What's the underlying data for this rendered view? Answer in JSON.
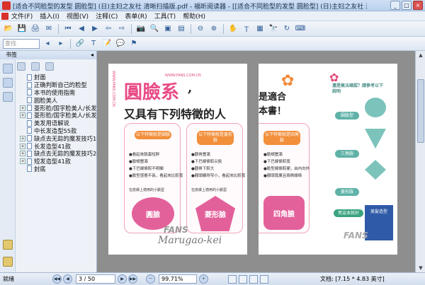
{
  "window": {
    "title": "[适合不同脸型的发型 圆脸型] (日)主妇之友社 清晰扫描版.pdf - 福昕阅读器 - [[适合不同脸型的发型 圆脸型] (日)主妇之友社 清晰扫描版.pdf]",
    "buttons": {
      "minimize": "_",
      "maximize": "□",
      "close": "×"
    }
  },
  "menu": {
    "items": [
      "文件(F)",
      "插入(I)",
      "视图(V)",
      "注释(C)",
      "表单(R)",
      "工具(T)",
      "帮助(H)"
    ]
  },
  "toolbar": {
    "search_placeholder": "查找",
    "zoom_out": "⊖",
    "zoom_in": "⊕",
    "prev": "◀",
    "next": "▶"
  },
  "bookmarks": {
    "header": "书签",
    "collapse": "◂",
    "items": [
      {
        "label": "封面",
        "toggle": ""
      },
      {
        "label": "正确判断自己的脸型",
        "toggle": ""
      },
      {
        "label": "本书的使用指南",
        "toggle": ""
      },
      {
        "label": "圆脸美人",
        "toggle": ""
      },
      {
        "label": "菱形脸/国字脸美人/长发",
        "toggle": "+"
      },
      {
        "label": "菱形脸/国字脸美人/长发",
        "toggle": "+"
      },
      {
        "label": "美发用语解说",
        "toggle": ""
      },
      {
        "label": "中长发造型55款",
        "toggle": ""
      },
      {
        "label": "缺点去无踪的魔发技巧1",
        "toggle": "+"
      },
      {
        "label": "长发造型41款",
        "toggle": "+"
      },
      {
        "label": "缺点去无踪的魔发技巧2",
        "toggle": "+"
      },
      {
        "label": "短发造型41款",
        "toggle": "+"
      },
      {
        "label": "封底",
        "toggle": ""
      }
    ]
  },
  "document": {
    "left_page": {
      "url": "WWW.FANS.COM.CN",
      "title": "圓臉系",
      "comma": ",",
      "subtitle": "又具有下列特徵的人",
      "cards": [
        {
          "tag": "以下特徵就是圓臉",
          "bullets": [
            "●看起來臉蛋短胖",
            "●臉頰豐滿",
            "●下巴線條較不明顯",
            "●臉型感覺不長，看起來比較寬"
          ],
          "note": "在皮膚上適用的小臉型",
          "shape": "圓臉"
        },
        {
          "tag": "以下特徵就是菱形臉",
          "bullets": [
            "●顴骨豐滿",
            "●下巴線條較尖銳",
            "●顴骨下較大",
            "●額頭顯得窄小，看起來比較寬"
          ],
          "note": "在皮膚上適用的小臉型",
          "shape": "菱形臉"
        }
      ],
      "script_text": "Marugao-kei",
      "watermark": "FANS"
    },
    "right_page": {
      "title_line1": "是適合",
      "title_line2": "本書！",
      "card": {
        "tag": "以下特徵就是四角臉",
        "bullets": [
          "●臉頰豐滿",
          "●下巴線條較寬",
          "●臉型線條較硬，由內向外",
          "●額頭寬廣且兩側線條"
        ],
        "shape": "四角臉"
      },
      "side_title": "還是無法確認？請參考以下說明",
      "side_labels": [
        "圓臉型",
        "三角臉",
        "菱形臉"
      ],
      "book_badge": "美髮造型",
      "promo": "買這本就好",
      "watermark": "FANS"
    }
  },
  "status": {
    "ready": "就绪",
    "page_current": "3",
    "page_total": "50",
    "page_display": "3 / 50",
    "zoom": "99.71%",
    "docinfo": "文档: [7.15 * 4.83 英寸]"
  }
}
